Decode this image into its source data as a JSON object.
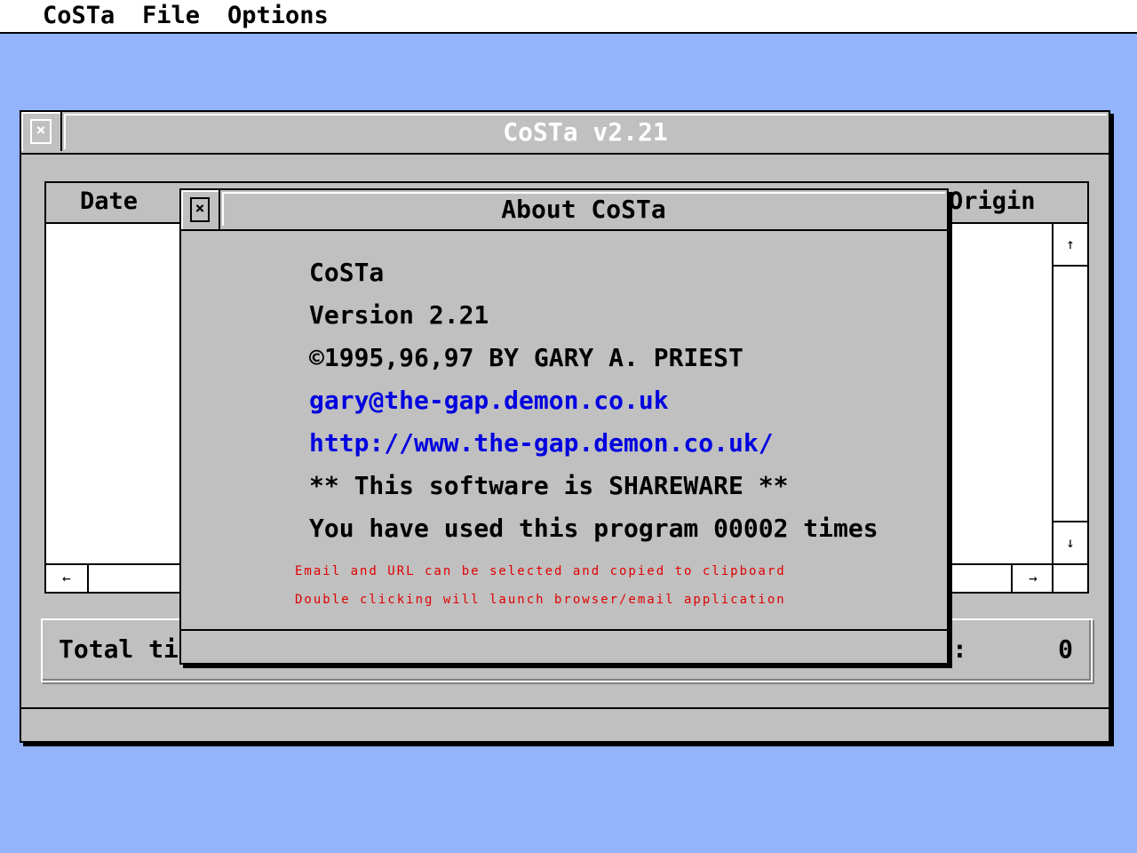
{
  "menubar": {
    "items": [
      {
        "label": "CoSTa"
      },
      {
        "label": "File"
      },
      {
        "label": "Options"
      }
    ]
  },
  "main_window": {
    "title": "CoSTa v2.21",
    "columns": [
      "Date",
      "Origin"
    ],
    "total_label": "Total tim",
    "total_colon": ":",
    "total_value": "0",
    "scroll": {
      "up": "↑",
      "down": "↓",
      "left": "←",
      "right": "→"
    }
  },
  "about_dialog": {
    "title": "About CoSTa",
    "app_name": "CoSTa",
    "version": "Version 2.21",
    "copyright": "©1995,96,97 BY GARY A. PRIEST",
    "email": "gary@the-gap.demon.co.uk",
    "url": "http://www.the-gap.demon.co.uk/",
    "shareware_notice": "** This software is SHAREWARE **",
    "usage_count": "You have used this program 00002 times",
    "hint_copy": "Email and URL can be selected and copied to clipboard",
    "hint_launch": "Double clicking will launch browser/email application"
  },
  "colors": {
    "desktop": "#93b3fb",
    "window": "#c0c0c0",
    "link": "#0000e0",
    "hint": "#e00000"
  }
}
